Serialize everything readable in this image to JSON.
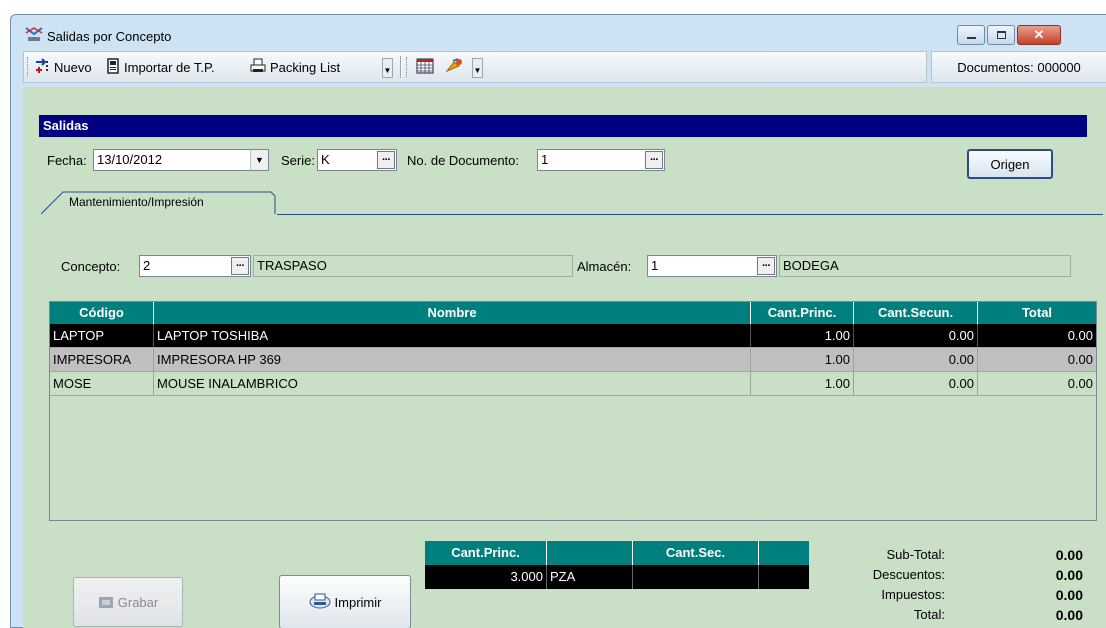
{
  "window": {
    "title": "Salidas por Concepto"
  },
  "toolbar": {
    "nuevo": "Nuevo",
    "importar": "Importar de T.P.",
    "packing": "Packing List",
    "documentos": "Documentos: 000000"
  },
  "section": {
    "title": "Salidas"
  },
  "form": {
    "fecha_label": "Fecha:",
    "fecha_value": "13/10/2012",
    "serie_label": "Serie:",
    "serie_value": "K",
    "nodoc_label": "No. de Documento:",
    "nodoc_value": "1",
    "origen_button": "Origen",
    "tab_label": "Mantenimiento/Impresión",
    "concepto_label": "Concepto:",
    "concepto_value": "2",
    "concepto_desc": "TRASPASO",
    "almacen_label": "Almacén:",
    "almacen_value": "1",
    "almacen_desc": "BODEGA"
  },
  "grid": {
    "columns": [
      "Código",
      "Nombre",
      "Cant.Princ.",
      "Cant.Secun.",
      "Total"
    ],
    "rows": [
      [
        "LAPTOP",
        "LAPTOP TOSHIBA",
        "1.00",
        "0.00",
        "0.00"
      ],
      [
        "IMPRESORA",
        "IMPRESORA HP 369",
        "1.00",
        "0.00",
        "0.00"
      ],
      [
        "MOSE",
        "MOUSE INALAMBRICO",
        "1.00",
        "0.00",
        "0.00"
      ]
    ]
  },
  "totals_grid": {
    "columns": [
      "Cant.Princ.",
      "",
      "Cant.Sec.",
      ""
    ],
    "row": [
      "3.000",
      "PZA",
      "",
      ""
    ]
  },
  "buttons": {
    "grabar": "Grabar",
    "imprimir": "Imprimir"
  },
  "summary": {
    "subtotal_label": "Sub-Total:",
    "subtotal_value": "0.00",
    "descuentos_label": "Descuentos:",
    "descuentos_value": "0.00",
    "impuestos_label": "Impuestos:",
    "impuestos_value": "0.00",
    "total_label": "Total:",
    "total_value": "0.00"
  },
  "colors": {
    "header_bar": "#000080",
    "grid_header": "#007f7f",
    "panel": "#c9e0c6",
    "selected_row": "#000000"
  }
}
